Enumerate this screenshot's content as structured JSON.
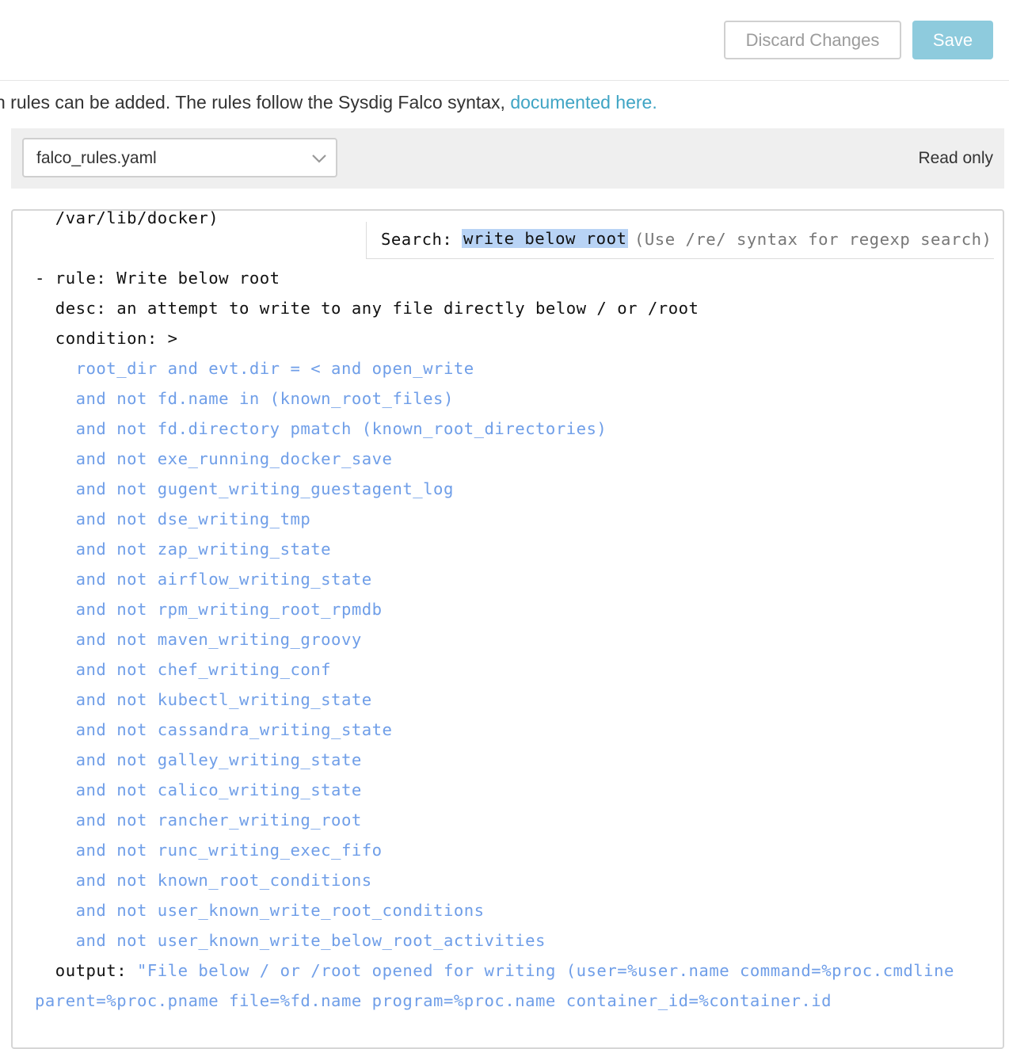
{
  "header": {
    "discard_label": "Discard Changes",
    "save_label": "Save"
  },
  "intro": {
    "text": "n rules can be added. The rules follow the Sysdig Falco syntax, ",
    "link": "documented here."
  },
  "toolbar": {
    "file_select_value": "falco_rules.yaml",
    "read_only_label": "Read only"
  },
  "search": {
    "label": "Search:",
    "query": "write below root",
    "hint": "(Use /re/ syntax for regexp search)"
  },
  "editor": {
    "lines": [
      {
        "text": "  /var/lib/docker)",
        "color": "black"
      },
      {
        "text": "",
        "color": "black"
      },
      {
        "text": "- rule: Write below root",
        "color": "black"
      },
      {
        "text": "  desc: an attempt to write to any file directly below / or /root",
        "color": "black"
      },
      {
        "text": "  condition: >",
        "color": "black"
      },
      {
        "text": "    root_dir and evt.dir = < and open_write",
        "color": "blue"
      },
      {
        "text": "    and not fd.name in (known_root_files)",
        "color": "blue"
      },
      {
        "text": "    and not fd.directory pmatch (known_root_directories)",
        "color": "blue"
      },
      {
        "text": "    and not exe_running_docker_save",
        "color": "blue"
      },
      {
        "text": "    and not gugent_writing_guestagent_log",
        "color": "blue"
      },
      {
        "text": "    and not dse_writing_tmp",
        "color": "blue"
      },
      {
        "text": "    and not zap_writing_state",
        "color": "blue"
      },
      {
        "text": "    and not airflow_writing_state",
        "color": "blue"
      },
      {
        "text": "    and not rpm_writing_root_rpmdb",
        "color": "blue"
      },
      {
        "text": "    and not maven_writing_groovy",
        "color": "blue"
      },
      {
        "text": "    and not chef_writing_conf",
        "color": "blue"
      },
      {
        "text": "    and not kubectl_writing_state",
        "color": "blue"
      },
      {
        "text": "    and not cassandra_writing_state",
        "color": "blue"
      },
      {
        "text": "    and not galley_writing_state",
        "color": "blue"
      },
      {
        "text": "    and not calico_writing_state",
        "color": "blue"
      },
      {
        "text": "    and not rancher_writing_root",
        "color": "blue"
      },
      {
        "text": "    and not runc_writing_exec_fifo",
        "color": "blue"
      },
      {
        "text": "    and not known_root_conditions",
        "color": "blue"
      },
      {
        "text": "    and not user_known_write_root_conditions",
        "color": "blue"
      },
      {
        "text": "    and not user_known_write_below_root_activities",
        "color": "blue"
      }
    ],
    "output_key": "  output: ",
    "output_value_1": "\"File below / or /root opened for writing (user=%user.name command=%proc.cmdline",
    "output_value_2": "parent=%proc.pname file=%fd.name program=%proc.name container_id=%container.id"
  },
  "colors": {
    "accent": "#3fa4c4",
    "save_button": "#8ecbdd",
    "code_blue": "#6f9ee8",
    "search_highlight": "#b8d3f5"
  }
}
